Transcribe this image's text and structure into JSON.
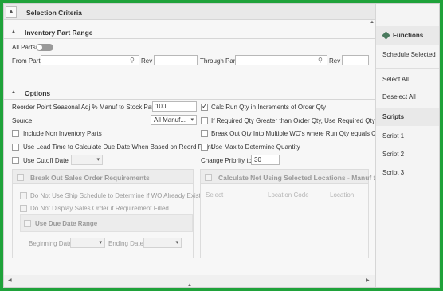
{
  "header": {
    "title": "Selection Criteria"
  },
  "inventory": {
    "title": "Inventory Part Range",
    "all_parts_label": "All Parts",
    "from_part_label": "From Part",
    "from_part_value": "",
    "rev_label_1": "Rev",
    "rev_value_1": "",
    "through_part_label": "Through Part",
    "through_part_value": "",
    "rev_label_2": "Rev",
    "rev_value_2": ""
  },
  "options": {
    "title": "Options",
    "reorder_label": "Reorder Point Seasonal Adj % Manuf to Stock Parts",
    "reorder_value": "100",
    "source_label": "Source",
    "source_value": "All Manuf...",
    "include_non_inv": "Include Non Inventory Parts",
    "lead_time": "Use Lead Time to Calculate Due Date When Based on Reord Point",
    "cutoff_date": "Use Cutoff Date",
    "calc_run_qty": "Calc Run Qty in Increments of Order Qty",
    "if_required": "If Required Qty Greater than Order Qty, Use Required Qty",
    "break_out_qty": "Break Out Qty Into Multiple WO's where Run Qty equals Order",
    "use_max": "Use Max to Determine Quantity",
    "change_priority_label": "Change Priority to",
    "change_priority_value": "30"
  },
  "sales_panel": {
    "title": "Break Out Sales Order Requirements",
    "no_ship_schedule": "Do Not Use Ship Schedule to Determine if WO Already Exists",
    "no_display": "Do Not Display Sales Order if Requirement Filled",
    "due_date_range": "Use Due Date Range",
    "beginning_date": "Beginning Date",
    "ending_date": "Ending Date"
  },
  "net_panel": {
    "title": "Calculate Net Using Selected Locations - Manuf to St",
    "columns": [
      "Select",
      "Location Code",
      "Location"
    ]
  },
  "sidebar": {
    "functions_title": "Functions",
    "functions": [
      "Schedule Selected",
      "Select All",
      "Deselect All"
    ],
    "scripts_title": "Scripts",
    "scripts": [
      "Script 1",
      "Script 2",
      "Script 3"
    ]
  }
}
